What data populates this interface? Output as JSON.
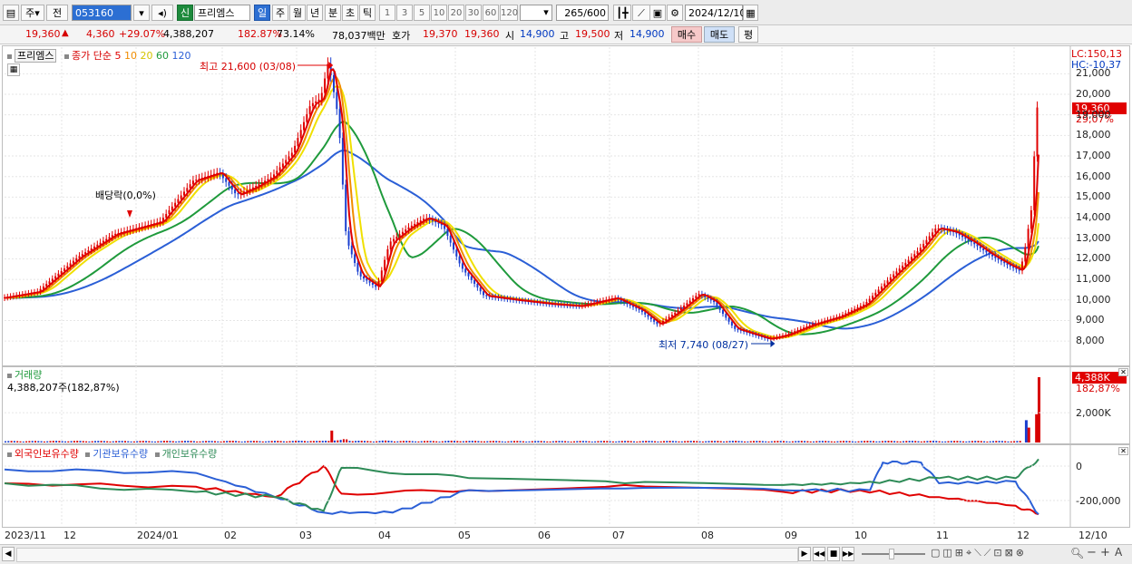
{
  "toolbar": {
    "mode_items": [
      "주",
      "전"
    ],
    "code": "053160",
    "name_badge": "신",
    "name": "프리엠스",
    "periods": [
      "일",
      "주",
      "월",
      "년",
      "분",
      "초",
      "틱"
    ],
    "selected_period": "일",
    "minute_options": [
      "1",
      "3",
      "5",
      "10",
      "20",
      "30",
      "60",
      "120"
    ],
    "count": "265",
    "count_max": "/600",
    "date": "2024/12/10"
  },
  "quote": {
    "price": "19,360",
    "change_arrow": "▲",
    "change": "4,360",
    "change_pct": "+29.07%",
    "volume": "4,388,207",
    "vol_ratio": "182.87%",
    "turnover": "73.14%",
    "amount": "78,037백만",
    "bid_label": "호가",
    "ask_price": "19,370",
    "bid_price": "19,360",
    "open_label": "시",
    "open": "14,900",
    "high_label": "고",
    "high": "19,500",
    "low_label": "저",
    "low": "14,900",
    "buy_label": "매수",
    "sell_label": "매도",
    "eval_label": "평"
  },
  "price_panel": {
    "name": "프리엠스",
    "ma_label": "종가 단순",
    "ma_periods": [
      "5",
      "10",
      "20",
      "60",
      "120"
    ],
    "ma_colors": [
      "#e00000",
      "#f08c00",
      "#f0e000",
      "#1f9a3c",
      "#2b5fd6"
    ],
    "high_note": "최고 21,600 (03/08)",
    "low_note": "최저 7,740 (08/27)",
    "dividend_note": "배당락(0,0%)",
    "lc": "LC:150,13",
    "hc": "HC:-10,37",
    "current_tag": "19,360",
    "current_pct": "29,07%",
    "y_ticks": [
      "21,000",
      "20,000",
      "19,000",
      "18,000",
      "17,000",
      "16,000",
      "15,000",
      "14,000",
      "13,000",
      "12,000",
      "11,000",
      "10,000",
      "9,000",
      "8,000"
    ]
  },
  "volume_panel": {
    "title": "거래량",
    "value_text": "4,388,207주(182,87%)",
    "tag": "4,388K",
    "tag_pct": "182,87%",
    "y_ticks": [
      "2,000K"
    ]
  },
  "holding_panel": {
    "series_names": [
      "외국인보유수량",
      "기관보유수량",
      "개인보유수량"
    ],
    "series_colors": [
      "#e00000",
      "#2b5fd6",
      "#2e8b57"
    ],
    "y_ticks": [
      "0",
      "-200,000"
    ]
  },
  "x_labels": [
    "2023/11",
    "12",
    "2024/01",
    "02",
    "03",
    "04",
    "05",
    "06",
    "07",
    "08",
    "09",
    "10",
    "11",
    "12",
    "12/10"
  ],
  "chart_data": {
    "type": "line",
    "title": "",
    "x_unit": "date",
    "ylim": [
      7500,
      21600
    ],
    "series": [
      {
        "name": "종가",
        "x": [
          "2023-11-01",
          "2023-11-15",
          "2023-12-01",
          "2023-12-15",
          "2024-01-02",
          "2024-01-15",
          "2024-01-25",
          "2024-02-01",
          "2024-02-08",
          "2024-02-15",
          "2024-02-23",
          "2024-03-01",
          "2024-03-05",
          "2024-03-08",
          "2024-03-12",
          "2024-03-15",
          "2024-03-20",
          "2024-03-27",
          "2024-04-01",
          "2024-04-08",
          "2024-04-15",
          "2024-04-22",
          "2024-04-29",
          "2024-05-08",
          "2024-05-20",
          "2024-06-03",
          "2024-06-14",
          "2024-06-28",
          "2024-07-08",
          "2024-07-15",
          "2024-07-22",
          "2024-07-31",
          "2024-08-06",
          "2024-08-14",
          "2024-08-27",
          "2024-09-03",
          "2024-09-13",
          "2024-09-24",
          "2024-10-04",
          "2024-10-15",
          "2024-10-25",
          "2024-11-01",
          "2024-11-08",
          "2024-11-15",
          "2024-11-22",
          "2024-11-29",
          "2024-12-04",
          "2024-12-06",
          "2024-12-09",
          "2024-12-10"
        ],
        "y": [
          10100,
          10400,
          12100,
          13200,
          13800,
          15800,
          16200,
          15100,
          15500,
          16000,
          17200,
          19500,
          19800,
          21600,
          18800,
          13000,
          11200,
          10600,
          12800,
          13500,
          14000,
          13600,
          11600,
          10200,
          10000,
          9800,
          9700,
          10100,
          9500,
          8800,
          9400,
          10300,
          9900,
          8600,
          8100,
          8300,
          8800,
          9200,
          9800,
          11200,
          12400,
          13500,
          13300,
          12800,
          12200,
          11700,
          11400,
          12600,
          14900,
          19360
        ]
      }
    ],
    "volume": {
      "unit": "shares",
      "x": [
        "2024-03-08",
        "2024-12-05",
        "2024-12-06",
        "2024-12-09",
        "2024-12-10"
      ],
      "values": [
        800000,
        1500000,
        1000000,
        1900000,
        4388207
      ]
    },
    "holding": {
      "ylim": [
        -300000,
        50000
      ],
      "series": [
        {
          "name": "외국인보유수량",
          "x": [
            "2023-11-01",
            "2024-01-15",
            "2024-02-15",
            "2024-03-05",
            "2024-03-12",
            "2024-05-01",
            "2024-07-01",
            "2024-09-01",
            "2024-10-01",
            "2024-11-01",
            "2024-12-01",
            "2024-12-10"
          ],
          "y": [
            -100000,
            -120000,
            -180000,
            0,
            -160000,
            -140000,
            -110000,
            -150000,
            -140000,
            -180000,
            -230000,
            -280000
          ]
        },
        {
          "name": "기관보유수량",
          "x": [
            "2023-11-01",
            "2024-01-15",
            "2024-02-15",
            "2024-03-05",
            "2024-04-01",
            "2024-05-01",
            "2024-07-01",
            "2024-09-01",
            "2024-10-05",
            "2024-10-10",
            "2024-10-25",
            "2024-11-01",
            "2024-12-01",
            "2024-12-10"
          ],
          "y": [
            -20000,
            -40000,
            -180000,
            -270000,
            -270000,
            -140000,
            -130000,
            -140000,
            -140000,
            20000,
            20000,
            -100000,
            -90000,
            -280000
          ]
        },
        {
          "name": "개인보유수량",
          "x": [
            "2023-11-01",
            "2024-01-15",
            "2024-02-15",
            "2024-03-05",
            "2024-03-12",
            "2024-05-01",
            "2024-07-01",
            "2024-09-01",
            "2024-10-01",
            "2024-11-01",
            "2024-12-01",
            "2024-12-10"
          ],
          "y": [
            -100000,
            -150000,
            -180000,
            -260000,
            -10000,
            -70000,
            -100000,
            -110000,
            -100000,
            -70000,
            -70000,
            40000
          ]
        }
      ]
    }
  }
}
